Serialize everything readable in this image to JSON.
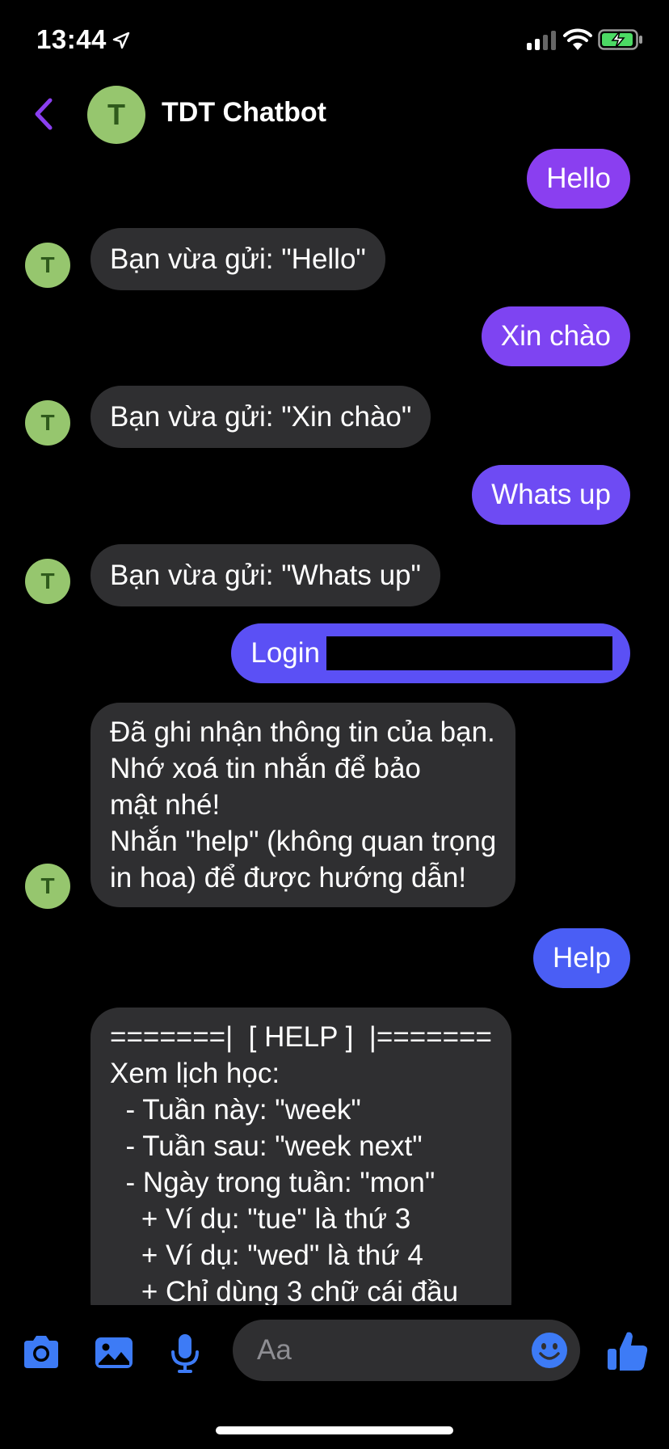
{
  "status": {
    "time": "13:44"
  },
  "header": {
    "title": "TDT Chatbot",
    "avatar_letter": "T"
  },
  "messages": [
    {
      "dir": "out",
      "text": "Hello",
      "color": "#8a3ff0"
    },
    {
      "dir": "in",
      "text": "Bạn vừa gửi: \"Hello\""
    },
    {
      "dir": "out",
      "text": "Xin chào",
      "color": "#7e44f2"
    },
    {
      "dir": "in",
      "text": "Bạn vừa gửi: \"Xin chào\""
    },
    {
      "dir": "out",
      "text": "Whats up",
      "color": "#6e4bf3"
    },
    {
      "dir": "in",
      "text": "Bạn vừa gửi: \"Whats up\""
    },
    {
      "dir": "out",
      "text": "Login",
      "color": "#5b50f5"
    },
    {
      "dir": "in",
      "text": "Đã ghi nhận thông tin của bạn.\nNhớ xoá tin nhắn để bảo\nmật nhé!\nNhắn \"help\" (không quan trọng\nin hoa) để được hướng dẫn!"
    },
    {
      "dir": "out",
      "text": "Help",
      "color": "#4a5ef5"
    },
    {
      "dir": "in",
      "text": "=======|  [ HELP ]  |=======\nXem lịch học:\n  - Tuần này: \"week\"\n  - Tuần sau: \"week next\"\n  - Ngày trong tuần: \"mon\"\n    + Ví dụ: \"tue\" là thứ 3\n    + Ví dụ: \"wed\" là thứ 4\n    + Chỉ dùng 3 chữ cái đầu"
    }
  ],
  "composer": {
    "placeholder": "Aa"
  },
  "colors": {
    "accent": "#8a3ff0",
    "icon_blue": "#3d7bf6",
    "avatar_green": "#96c66e"
  }
}
